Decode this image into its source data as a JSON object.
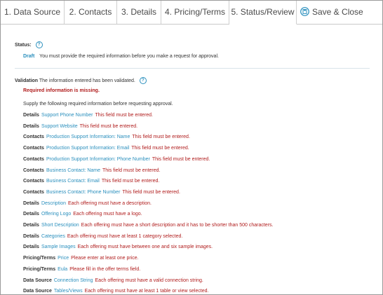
{
  "tabs": [
    {
      "label": "1. Data Source"
    },
    {
      "label": "2. Contacts"
    },
    {
      "label": "3. Details"
    },
    {
      "label": "4. Pricing/Terms"
    },
    {
      "label": "5. Status/Review"
    }
  ],
  "save_close": {
    "label": "Save & Close",
    "icon": "save-disk-icon"
  },
  "status": {
    "label": "Status:",
    "value": "Draft",
    "message": "You must provide the required information before you make a request for approval."
  },
  "validation": {
    "label": "Validation",
    "message": "The information entered has been validated.",
    "missing": "Required information is missing.",
    "supply": "Supply the following required information before requesting approval.",
    "items": [
      {
        "section": "Details",
        "field": "Support Phone Number",
        "message": "This field must be entered."
      },
      {
        "section": "Details",
        "field": "Support Website",
        "message": "This field must be entered."
      },
      {
        "section": "Contacts",
        "field": "Production Support Information: Name",
        "message": "This field must be entered."
      },
      {
        "section": "Contacts",
        "field": "Production Support Information: Email",
        "message": "This field must be entered."
      },
      {
        "section": "Contacts",
        "field": "Production Support Information: Phone Number",
        "message": "This field must be entered."
      },
      {
        "section": "Contacts",
        "field": "Business Contact: Name",
        "message": "This field must be entered."
      },
      {
        "section": "Contacts",
        "field": "Business Contact: Email",
        "message": "This field must be entered."
      },
      {
        "section": "Contacts",
        "field": "Business Contact: Phone Number",
        "message": "This field must be entered."
      },
      {
        "section": "Details",
        "field": "Description",
        "message": "Each offering must have a description."
      },
      {
        "section": "Details",
        "field": "Offering Logo",
        "message": "Each offering must have a logo."
      },
      {
        "section": "Details",
        "field": "Short Description",
        "message": "Each offering must have a short description and it has to be shorter than 500 characters."
      },
      {
        "section": "Details",
        "field": "Categories",
        "message": "Each offering must have at least 1 category selected."
      },
      {
        "section": "Details",
        "field": "Sample Images",
        "message": "Each offering must have between one and six sample images."
      },
      {
        "section": "Pricing/Terms",
        "field": "Price",
        "message": "Please enter at least one price."
      },
      {
        "section": "Pricing/Terms",
        "field": "Eula",
        "message": "Please fill in the offer terms field."
      },
      {
        "section": "Data Source",
        "field": "Connection String",
        "message": "Each offering must have a valid connection string."
      },
      {
        "section": "Data Source",
        "field": "Tables/Views",
        "message": "Each offering must have at least 1 table or view selected."
      }
    ]
  },
  "colors": {
    "link": "#2a8fbd",
    "error": "#b01c1c",
    "text": "#333333"
  }
}
